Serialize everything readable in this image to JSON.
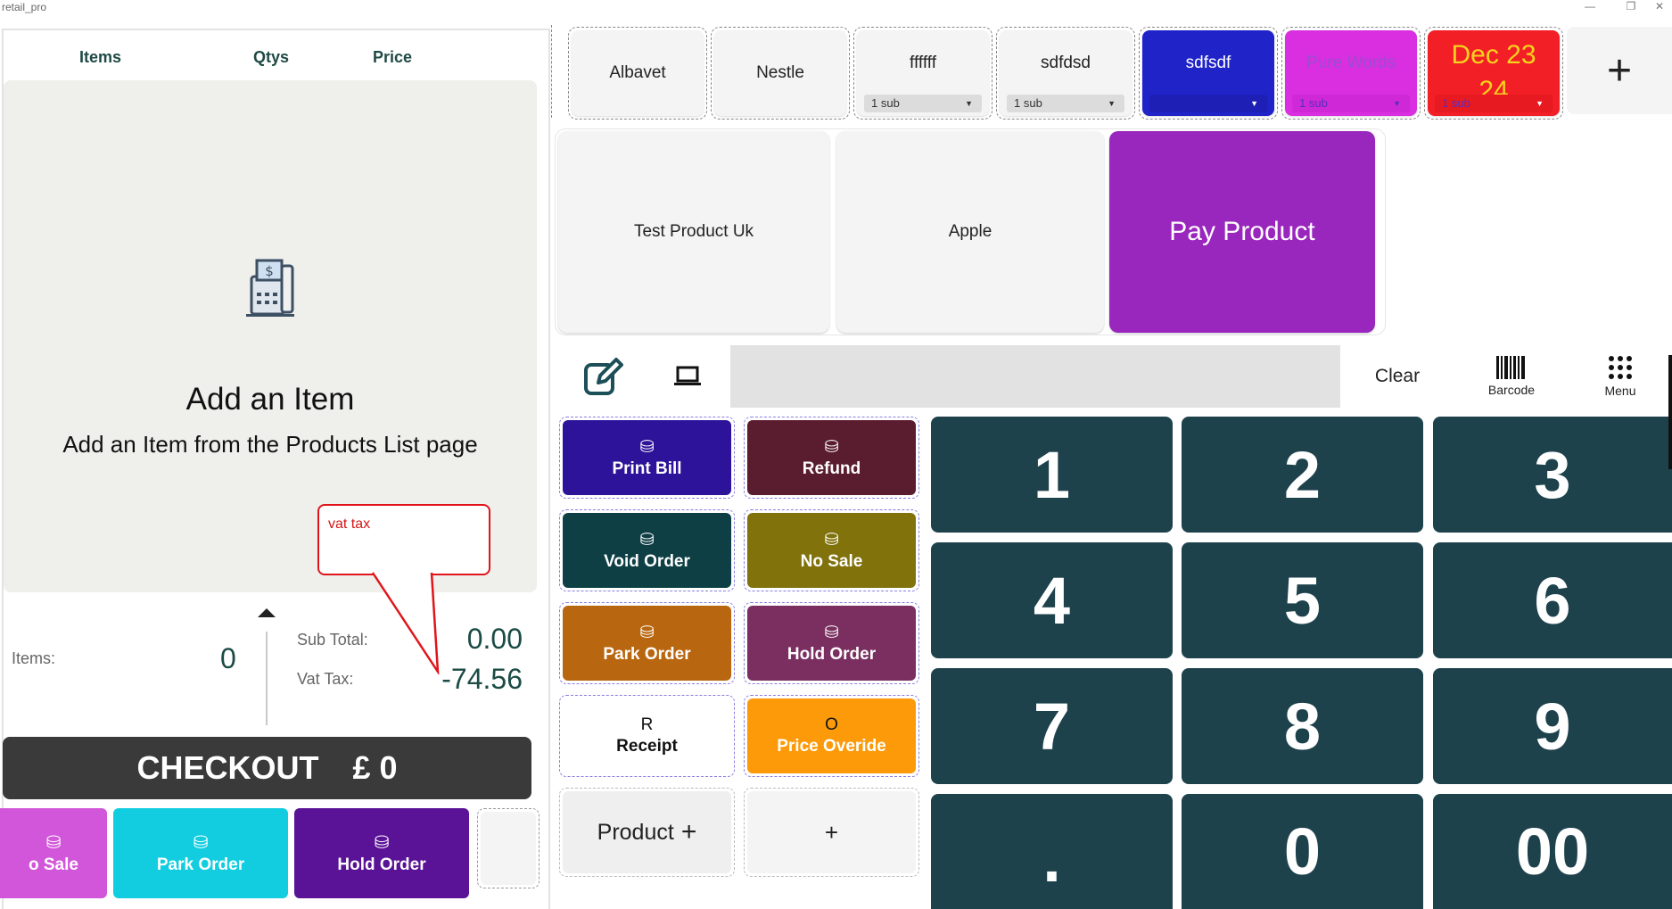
{
  "window": {
    "title": "retail_pro",
    "min": "—",
    "restore": "❐",
    "close": "✕"
  },
  "order_list": {
    "headers": {
      "items": "Items",
      "qtys": "Qtys",
      "price": "Price"
    },
    "empty_title": "Add an Item",
    "empty_subtitle": "Add an Item from the Products List page"
  },
  "callout": {
    "text": "vat tax"
  },
  "summary": {
    "items_label": "Items:",
    "items_value": "0",
    "subtotal_label": "Sub Total:",
    "subtotal_value": "0.00",
    "vat_label": "Vat Tax:",
    "vat_value": "-74.56"
  },
  "checkout": {
    "label": "CHECKOUT",
    "amount": "£ 0"
  },
  "bottom_buttons": [
    {
      "label": "o Sale",
      "color": "#d256d9"
    },
    {
      "label": "Park Order",
      "color": "#12cde0"
    },
    {
      "label": "Hold Order",
      "color": "#5a1296"
    }
  ],
  "categories": [
    {
      "label": "Albavet",
      "sub": "",
      "bg": "#f4f4f4",
      "fg": "#222222"
    },
    {
      "label": "Nestle",
      "sub": "",
      "bg": "#f4f4f4",
      "fg": "#222222"
    },
    {
      "label": "ffffff",
      "sub": "1 sub",
      "bg": "#f4f4f4",
      "fg": "#222222"
    },
    {
      "label": "sdfdsd",
      "sub": "1 sub",
      "bg": "#f4f4f4",
      "fg": "#222222"
    },
    {
      "label": "sdfsdf",
      "sub": "1 sub",
      "bg": "#1f23c8",
      "fg": "#ffffff"
    },
    {
      "label": "Pure Words",
      "sub": "1 sub",
      "bg": "#d92fe0",
      "fg": "#9a4dd0"
    },
    {
      "label": "Dec 23 24",
      "sub": "1 sub",
      "bg": "#f21f26",
      "fg": "#f7d21e"
    }
  ],
  "add_category": "+",
  "products": [
    {
      "label": "Test Product Uk"
    },
    {
      "label": "Apple"
    },
    {
      "label": "Pay Product"
    }
  ],
  "toolbar": {
    "clear": "Clear",
    "barcode": "Barcode",
    "menu": "Menu"
  },
  "actions": [
    {
      "label": "Print Bill",
      "color": "#2c1399"
    },
    {
      "label": "Refund",
      "color": "#5a1c2f"
    },
    {
      "label": "Void Order",
      "color": "#0d3f45"
    },
    {
      "label": "No Sale",
      "color": "#81720c"
    },
    {
      "label": "Park Order",
      "color": "#b8660f"
    },
    {
      "label": "Hold Order",
      "color": "#7a2f60"
    },
    {
      "label": "Receipt",
      "glyph": "R",
      "color": "#ffffff"
    },
    {
      "label": "Price Overide",
      "glyph": "O",
      "color": "#fc9a0a"
    },
    {
      "label": "Product",
      "color": "#efefef"
    },
    {
      "label": "+",
      "color": "#f4f4f4"
    }
  ],
  "numpad": [
    "1",
    "2",
    "3",
    "4",
    "5",
    "6",
    "7",
    "8",
    "9",
    ".",
    "0",
    "00"
  ]
}
